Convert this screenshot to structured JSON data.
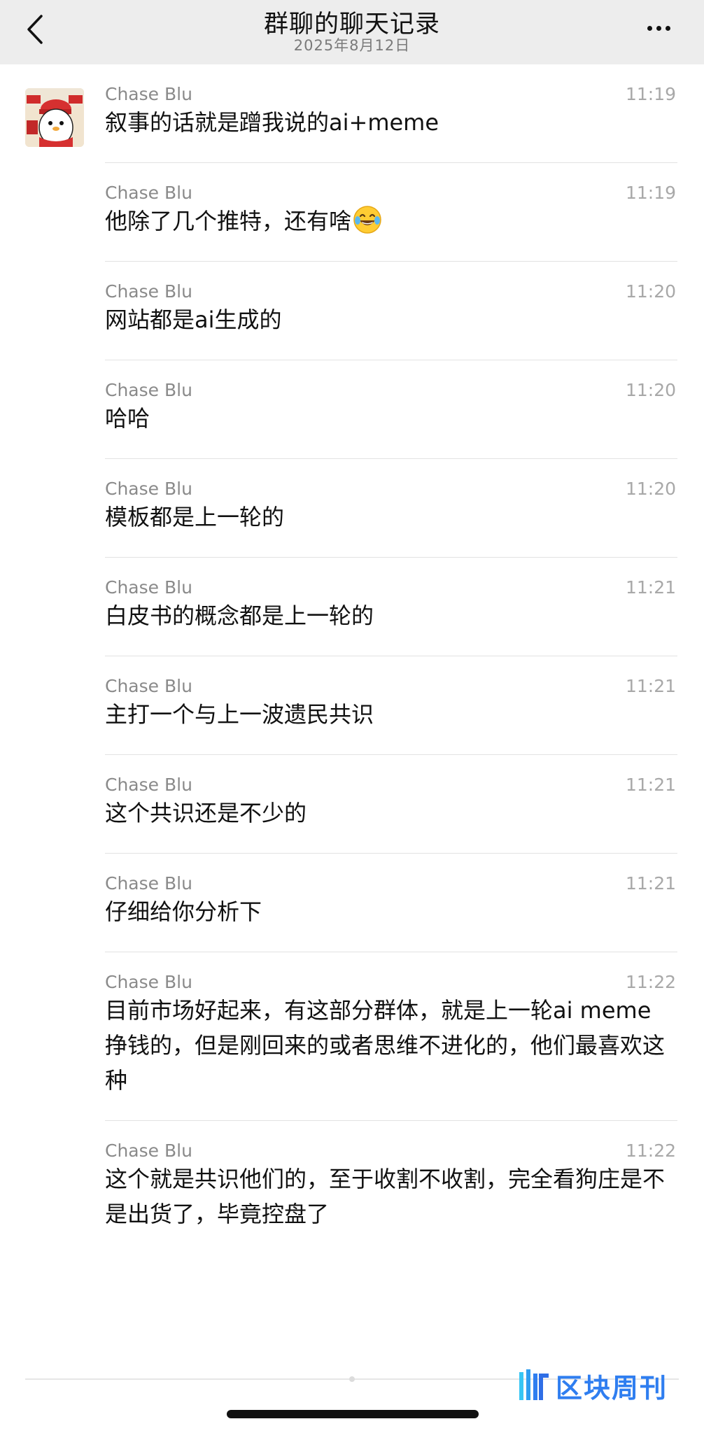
{
  "header": {
    "title": "群聊的聊天记录",
    "subtitle": "2025年8月12日"
  },
  "messages": [
    {
      "sender": "Chase Blu",
      "time": "11:19",
      "text": "叙事的话就是蹭我说的ai+meme"
    },
    {
      "sender": "Chase Blu",
      "time": "11:19",
      "text": "他除了几个推特，还有啥",
      "emoji": "laughing-tears-emoji"
    },
    {
      "sender": "Chase Blu",
      "time": "11:20",
      "text": "网站都是ai生成的"
    },
    {
      "sender": "Chase Blu",
      "time": "11:20",
      "text": "哈哈"
    },
    {
      "sender": "Chase Blu",
      "time": "11:20",
      "text": "模板都是上一轮的"
    },
    {
      "sender": "Chase Blu",
      "time": "11:21",
      "text": "白皮书的概念都是上一轮的"
    },
    {
      "sender": "Chase Blu",
      "time": "11:21",
      "text": "主打一个与上一波遗民共识"
    },
    {
      "sender": "Chase Blu",
      "time": "11:21",
      "text": "这个共识还是不少的"
    },
    {
      "sender": "Chase Blu",
      "time": "11:21",
      "text": "仔细给你分析下"
    },
    {
      "sender": "Chase Blu",
      "time": "11:22",
      "text": "目前市场好起来，有这部分群体，就是上一轮ai meme挣钱的，但是刚回来的或者思维不进化的，他们最喜欢这种"
    },
    {
      "sender": "Chase Blu",
      "time": "11:22",
      "text": "这个就是共识他们的，至于收割不收割，完全看狗庄是不是出货了，毕竟控盘了"
    }
  ],
  "watermark": {
    "text": "区块周刊",
    "icon": "block-weekly-logo-icon"
  },
  "colors": {
    "header_bg": "#ededed",
    "sender": "#8a8a8a",
    "time": "#a8a8a8",
    "divider": "#e2e2e2",
    "watermark": "#2f7ef0"
  }
}
